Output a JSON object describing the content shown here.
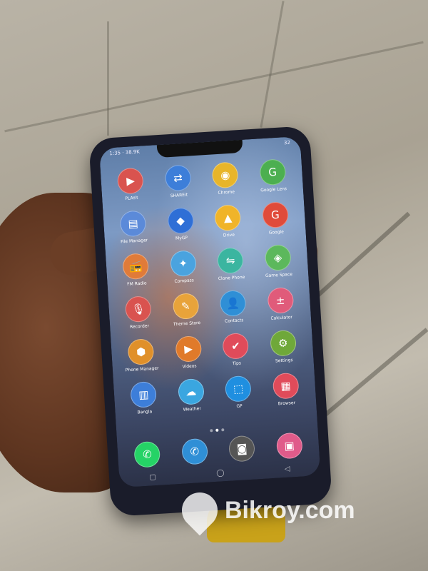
{
  "status_bar": {
    "time": "1:35 · 38.9K",
    "battery": "32"
  },
  "apps": [
    {
      "label": "PLAYit",
      "icon": "play-icon",
      "glyph": "▶",
      "color": "#d9534f"
    },
    {
      "label": "SHAREit",
      "icon": "share-icon",
      "glyph": "⇄",
      "color": "#3d7ed9"
    },
    {
      "label": "Chrome",
      "icon": "chrome-icon",
      "glyph": "◉",
      "color": "#e8b52a"
    },
    {
      "label": "Google Lens",
      "icon": "google-icon",
      "glyph": "G",
      "color": "#4caf50"
    },
    {
      "label": "File Manager",
      "icon": "folder-icon",
      "glyph": "▤",
      "color": "#5b8ad9"
    },
    {
      "label": "MyGP",
      "icon": "mygp-icon",
      "glyph": "◆",
      "color": "#2f6fd6"
    },
    {
      "label": "Drive",
      "icon": "drive-icon",
      "glyph": "▲",
      "color": "#f0b429"
    },
    {
      "label": "Google",
      "icon": "google-icon",
      "glyph": "G",
      "color": "#e04b3a"
    },
    {
      "label": "FM Radio",
      "icon": "radio-icon",
      "glyph": "📻",
      "color": "#e07b39"
    },
    {
      "label": "Compass",
      "icon": "compass-icon",
      "glyph": "✦",
      "color": "#4aa3df"
    },
    {
      "label": "Clone Phone",
      "icon": "clone-icon",
      "glyph": "⇋",
      "color": "#3bb5a0"
    },
    {
      "label": "Game Space",
      "icon": "game-icon",
      "glyph": "◈",
      "color": "#5cb85c"
    },
    {
      "label": "Recorder",
      "icon": "mic-icon",
      "glyph": "🎙",
      "color": "#d9534f"
    },
    {
      "label": "Theme Store",
      "icon": "brush-icon",
      "glyph": "✎",
      "color": "#e8a33a"
    },
    {
      "label": "Contacts",
      "icon": "contacts-icon",
      "glyph": "👤",
      "color": "#2f8fd6"
    },
    {
      "label": "Calculator",
      "icon": "calculator-icon",
      "glyph": "±",
      "color": "#e05b7a"
    },
    {
      "label": "Phone Manager",
      "icon": "shield-icon",
      "glyph": "⬢",
      "color": "#e0902a"
    },
    {
      "label": "Videos",
      "icon": "video-icon",
      "glyph": "▶",
      "color": "#e07a2a"
    },
    {
      "label": "Tips",
      "icon": "tips-icon",
      "glyph": "✔",
      "color": "#e04b5a"
    },
    {
      "label": "Settings",
      "icon": "gear-icon",
      "glyph": "⚙",
      "color": "#6fa83a"
    },
    {
      "label": "Bangla",
      "icon": "book-icon",
      "glyph": "▥",
      "color": "#3d7ed9"
    },
    {
      "label": "Weather",
      "icon": "weather-icon",
      "glyph": "☁",
      "color": "#3aa6e0"
    },
    {
      "label": "GP",
      "icon": "gp-icon",
      "glyph": "⬚",
      "color": "#1f8fe0"
    },
    {
      "label": "Browser",
      "icon": "browser-icon",
      "glyph": "▦",
      "color": "#e04b5a"
    }
  ],
  "dock": [
    {
      "label": "",
      "icon": "whatsapp-icon",
      "glyph": "✆",
      "color": "#25d366"
    },
    {
      "label": "",
      "icon": "phone-icon",
      "glyph": "✆",
      "color": "#2f8fd6"
    },
    {
      "label": "",
      "icon": "camera-icon",
      "glyph": "◙",
      "color": "#555555"
    },
    {
      "label": "",
      "icon": "gallery-icon",
      "glyph": "▣",
      "color": "#e05b8a"
    }
  ],
  "page_indicator": {
    "count": 3,
    "active": 2
  },
  "watermark": {
    "text": "Bikroy.com"
  }
}
